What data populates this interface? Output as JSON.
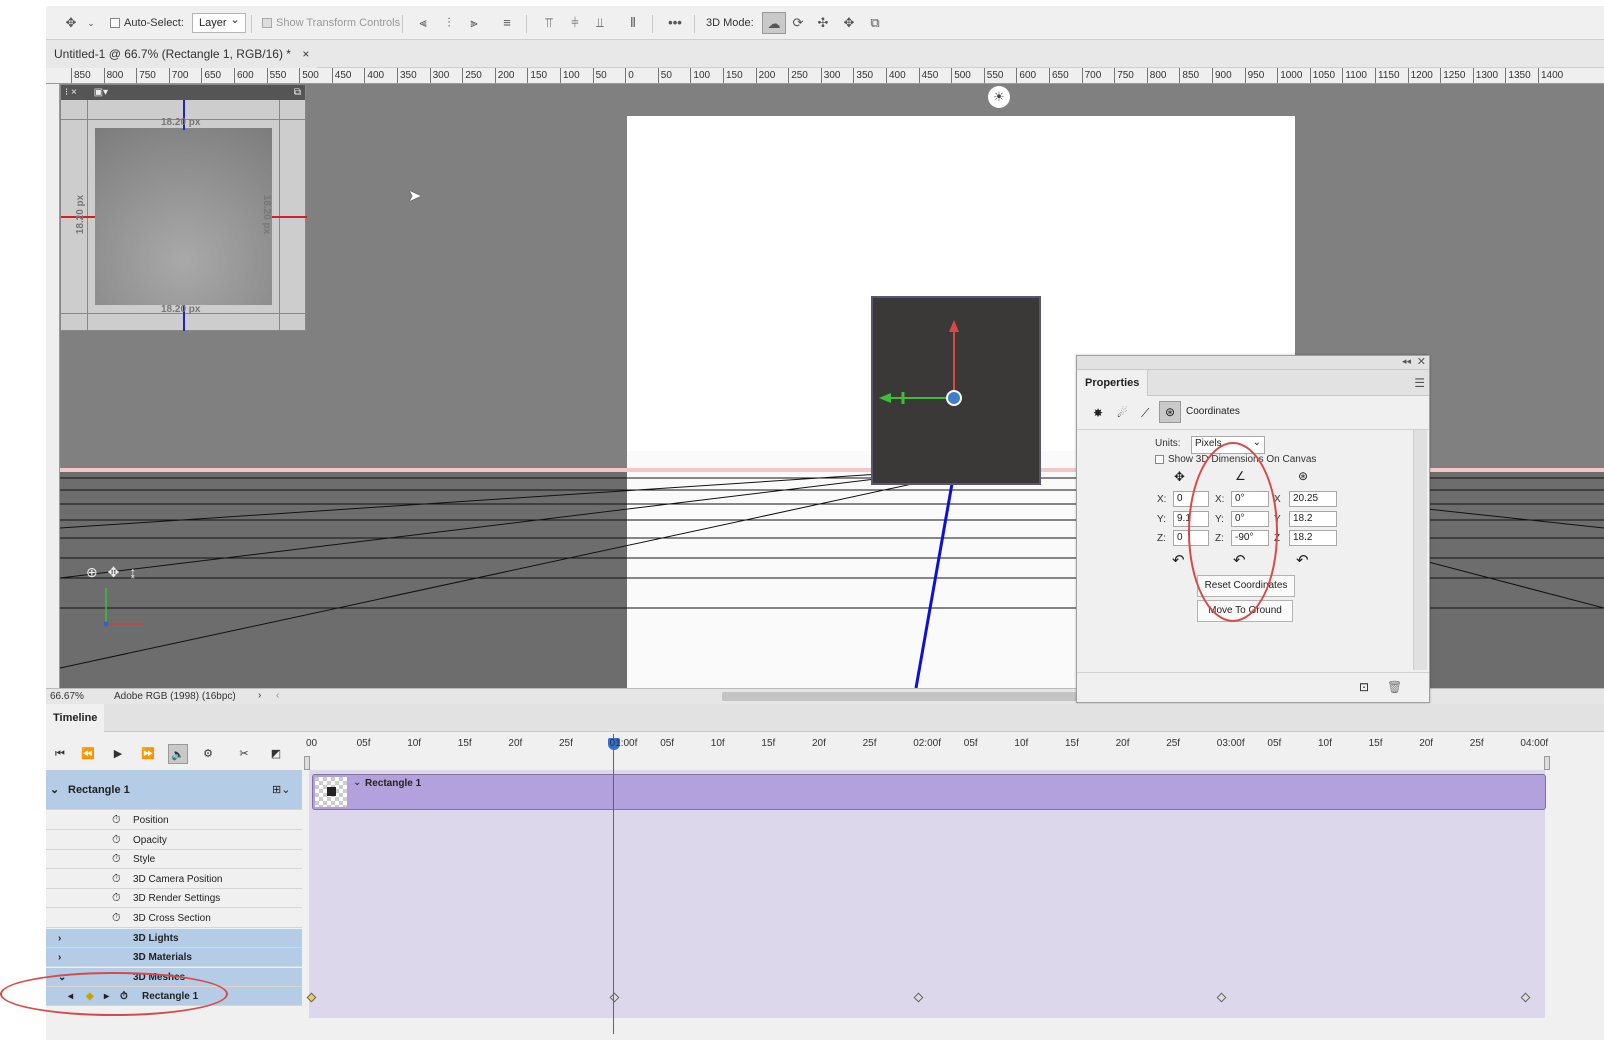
{
  "options_bar": {
    "auto_select_label": "Auto-Select:",
    "layer_select": "Layer",
    "show_transform_controls": "Show Transform Controls",
    "mode_label": "3D Mode:"
  },
  "document_tab": {
    "title": "Untitled-1 @ 66.7% (Rectangle 1, RGB/16) *",
    "close": "×"
  },
  "h_ruler": [
    "850",
    "800",
    "750",
    "700",
    "650",
    "600",
    "550",
    "500",
    "450",
    "400",
    "350",
    "300",
    "250",
    "200",
    "150",
    "100",
    "50",
    "0",
    "50",
    "100",
    "150",
    "200",
    "250",
    "300",
    "350",
    "400",
    "450",
    "500",
    "550",
    "600",
    "650",
    "700",
    "750",
    "800",
    "850",
    "900",
    "950",
    "1000",
    "1050",
    "1100",
    "1150",
    "1200",
    "1250",
    "1300",
    "1350",
    "1400"
  ],
  "secondary_view": {
    "top_label": "18.20 px",
    "bottom_label": "18.20 px",
    "left_label": "18.20 px",
    "right_label": "18.20 px"
  },
  "status_bar": {
    "zoom": "66.67%",
    "profile": "Adobe RGB (1998) (16bpc)"
  },
  "properties": {
    "tab": "Properties",
    "section": "Coordinates",
    "units_label": "Units:",
    "units_value": "Pixels",
    "show_dims_label": "Show 3D Dimensions On Canvas",
    "position": {
      "x_label": "X:",
      "x": "0",
      "y_label": "Y:",
      "y": "9.1",
      "z_label": "Z:",
      "z": "0"
    },
    "rotation": {
      "x_label": "X:",
      "x": "0°",
      "y_label": "Y:",
      "y": "0°",
      "z_label": "Z:",
      "z": "-90°"
    },
    "scale": {
      "x_label": "X",
      "x": "20.25",
      "y_label": "Y",
      "y": "18.2",
      "z_label": "Z",
      "z": "18.2"
    },
    "reset_button": "Reset Coordinates",
    "ground_button": "Move To Ground"
  },
  "timeline": {
    "tab": "Timeline",
    "ruler": [
      "00",
      "05f",
      "10f",
      "15f",
      "20f",
      "25f",
      "01:00f",
      "05f",
      "10f",
      "15f",
      "20f",
      "25f",
      "02:00f",
      "05f",
      "10f",
      "15f",
      "20f",
      "25f",
      "03:00f",
      "05f",
      "10f",
      "15f",
      "20f",
      "25f",
      "04:00f"
    ],
    "group_name": "Rectangle 1",
    "clip_name": "Rectangle 1",
    "properties": [
      "Position",
      "Opacity",
      "Style",
      "3D Camera Position",
      "3D Render Settings",
      "3D Cross Section"
    ],
    "groups": [
      "3D Lights",
      "3D Materials",
      "3D Meshes"
    ],
    "mesh_item": "Rectangle 1"
  },
  "colors": {
    "accent_red": "#d64a4a",
    "layer_blue": "#b4cce6",
    "clip_purple": "#b3a1dd"
  }
}
